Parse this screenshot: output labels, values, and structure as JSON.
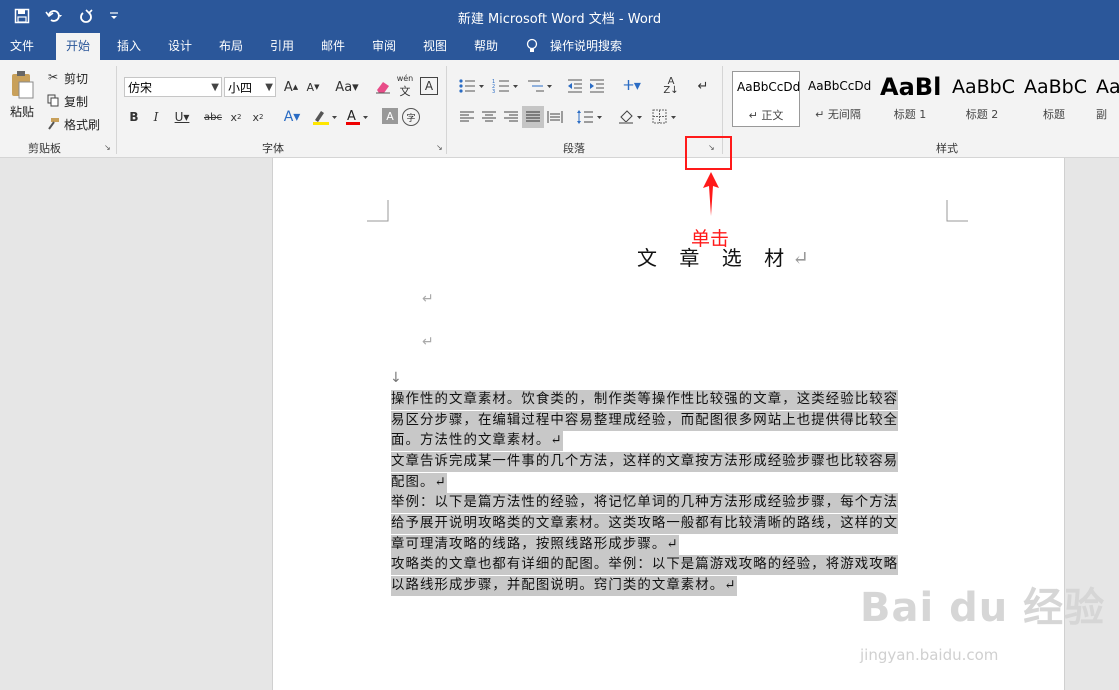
{
  "window": {
    "title": "新建 Microsoft Word 文档  -  Word"
  },
  "tabs": [
    {
      "label": "文件"
    },
    {
      "label": "开始"
    },
    {
      "label": "插入"
    },
    {
      "label": "设计"
    },
    {
      "label": "布局"
    },
    {
      "label": "引用"
    },
    {
      "label": "邮件"
    },
    {
      "label": "审阅"
    },
    {
      "label": "视图"
    },
    {
      "label": "帮助"
    }
  ],
  "tell_me": "操作说明搜索",
  "clipboard": {
    "paste": "粘贴",
    "cut": "剪切",
    "copy": "复制",
    "format_painter": "格式刷",
    "group": "剪贴板"
  },
  "font": {
    "name": "仿宋",
    "size": "小四",
    "group": "字体",
    "change_case": "Aa",
    "wen": "wén"
  },
  "paragraph": {
    "group": "段落"
  },
  "styles": {
    "group": "样式",
    "items": [
      {
        "sample": "AaBbCcDd",
        "name": "↵ 正文"
      },
      {
        "sample": "AaBbCcDd",
        "name": "↵ 无间隔"
      },
      {
        "sample": "AaBl",
        "name": "标题 1"
      },
      {
        "sample": "AaBbC",
        "name": "标题 2"
      },
      {
        "sample": "AaBbC",
        "name": "标题"
      },
      {
        "sample": "AaBbC",
        "name": "副"
      }
    ]
  },
  "document": {
    "title": "文 章 选 材",
    "title_mark": "↵",
    "empty_mark": "↵",
    "section_mark": "↓",
    "lines": [
      "操作性的文章素材。饮食类的，制作类等操作性比较强的文章，这类经验比较容",
      "易区分步骤，在编辑过程中容易整理成经验，而配图很多网站上也提供得比较全",
      "面。方法性的文章素材。↵",
      "文章告诉完成某一件事的几个方法，这样的文章按方法形成经验步骤也比较容易",
      "配图。↵",
      "举例：以下是篇方法性的经验，将记忆单词的几种方法形成经验步骤，每个方法",
      "给予展开说明攻略类的文章素材。这类攻略一般都有比较清晰的路线，这样的文",
      "章可理清攻略的线路，按照线路形成步骤。↵",
      "攻略类的文章也都有详细的配图。举例：以下是篇游戏攻略的经验，将游戏攻略",
      "以路线形成步骤，并配图说明。窍门类的文章素材。↵"
    ]
  },
  "annotation": {
    "label": "单击",
    "color": "#ff1a1a"
  },
  "watermark": {
    "brand": "Bai du 经验",
    "url": "jingyan.baidu.com"
  },
  "colors": {
    "accent": "#2b579a",
    "annotation": "#ff1a1a"
  }
}
